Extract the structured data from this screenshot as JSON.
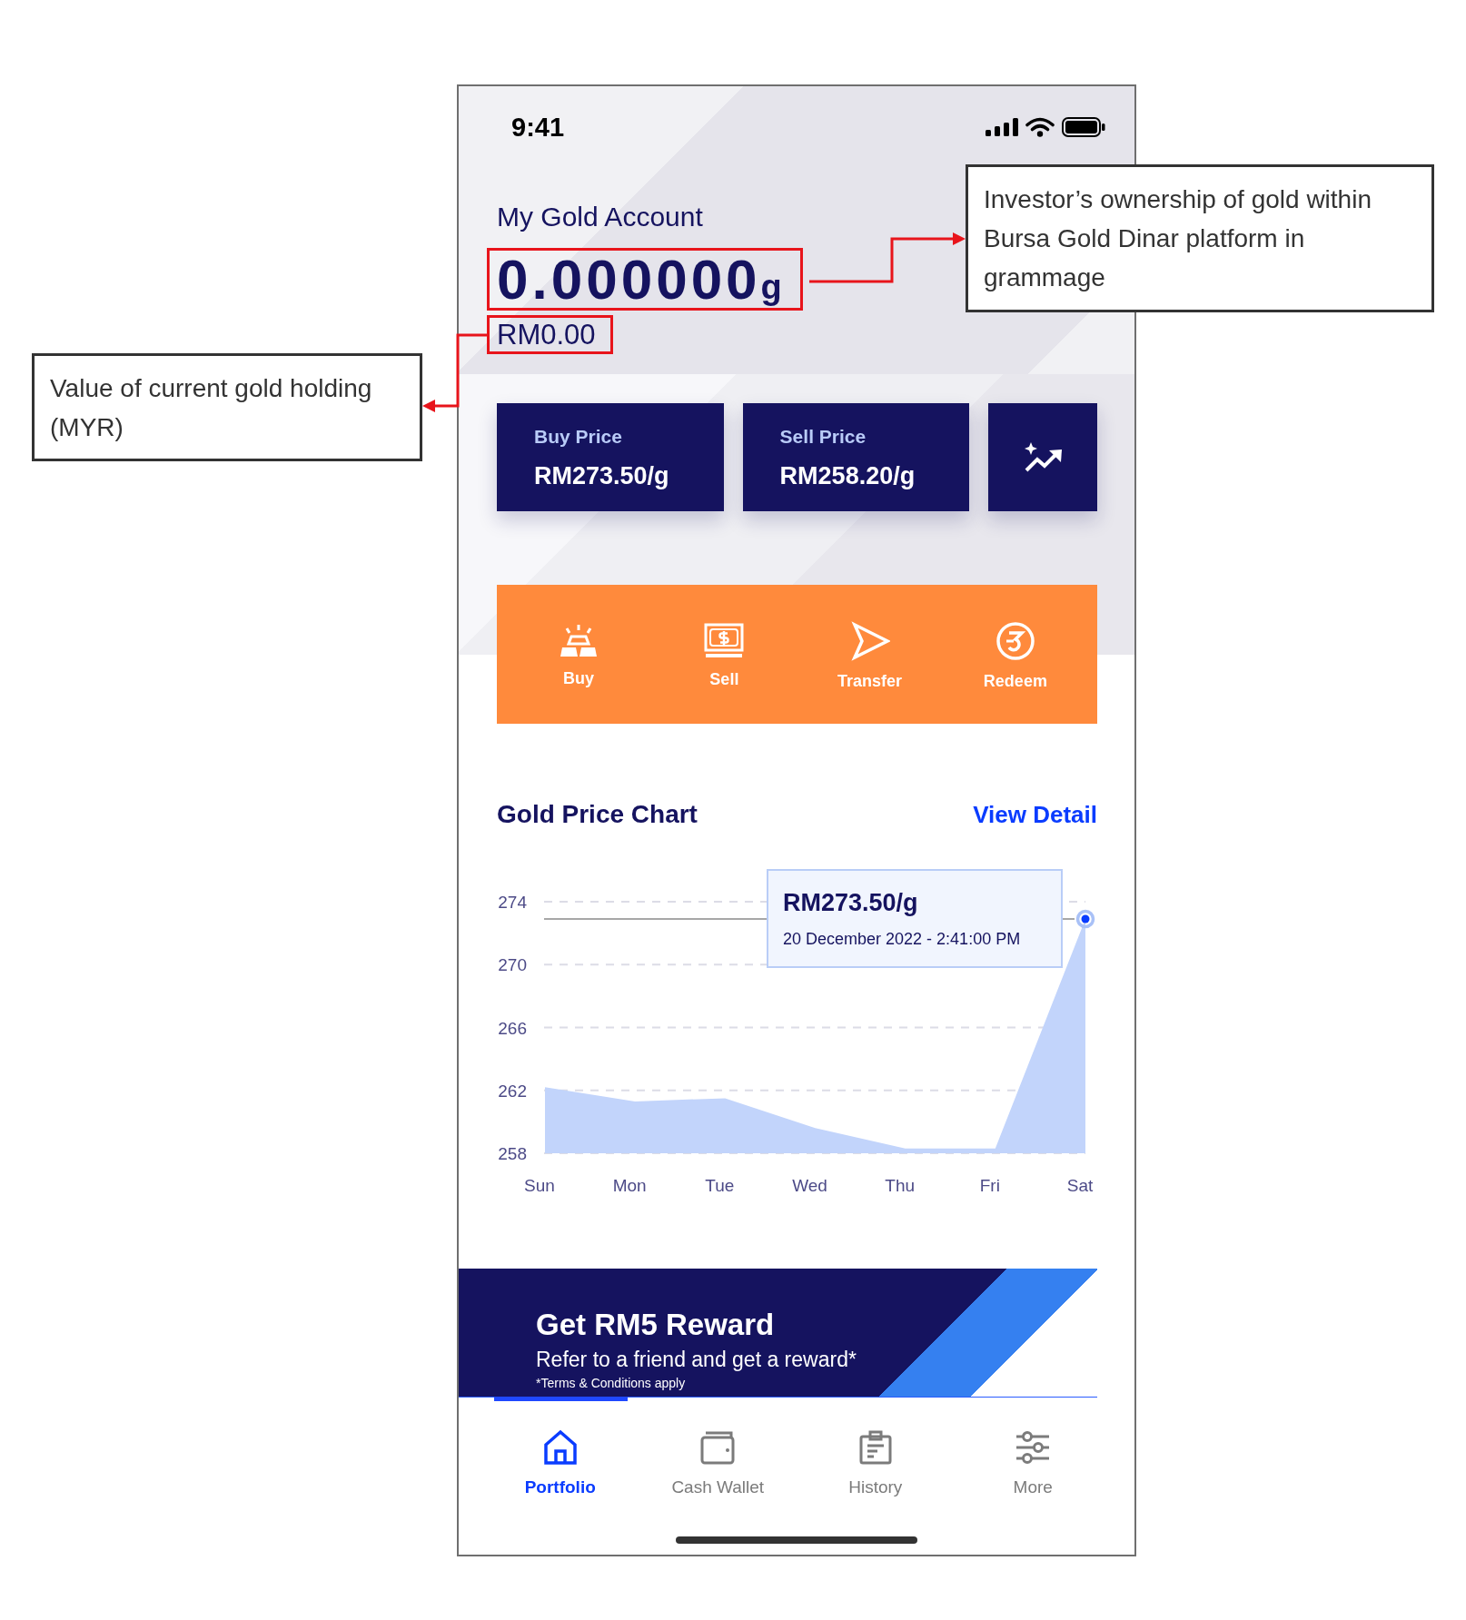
{
  "status_bar": {
    "time": "9:41"
  },
  "account": {
    "title": "My Gold Account",
    "balance": "0.000000",
    "unit": "g",
    "value": "RM0.00"
  },
  "price_cards": [
    {
      "label": "Buy Price",
      "value": "RM273.50/g"
    },
    {
      "label": "Sell Price",
      "value": "RM258.20/g"
    }
  ],
  "actions": [
    {
      "kind": "buy",
      "label": "Buy"
    },
    {
      "kind": "sell",
      "label": "Sell"
    },
    {
      "kind": "transfer",
      "label": "Transfer"
    },
    {
      "kind": "redeem",
      "label": "Redeem"
    }
  ],
  "gold_price_chart": {
    "title": "Gold Price Chart",
    "link": "View Detail",
    "chart_data": {
      "type": "area",
      "categories": [
        "Sun",
        "Mon",
        "Tue",
        "Wed",
        "Thu",
        "Fri",
        "Sat"
      ],
      "series": [
        {
          "color": "#c2d4fb",
          "values": [
            262.2,
            261.3,
            261.5,
            259.6,
            258.3,
            258.3,
            272.9
          ]
        }
      ],
      "ylim": [
        258,
        274
      ],
      "yticks": [
        258,
        262,
        266,
        270,
        274
      ],
      "grid": true,
      "ref_lines": [
        {
          "axis": "y",
          "value": 272.9
        }
      ]
    },
    "tooltip": {
      "price": "RM273.50/g",
      "timestamp": "20 December 2022 - 2:41:00 PM"
    }
  },
  "promo_banner": {
    "title": "Get RM5 Reward",
    "subtitle": "Refer to a friend and get a reward*",
    "terms": "*Terms & Conditions apply"
  },
  "bottom_nav": [
    {
      "kind": "home",
      "label": "Portfolio",
      "selected": true
    },
    {
      "kind": "wallet",
      "label": "Cash Wallet",
      "selected": false
    },
    {
      "kind": "history",
      "label": "History",
      "selected": false
    },
    {
      "kind": "more",
      "label": "More",
      "selected": false
    }
  ],
  "annotations": [
    {
      "kind": "balance",
      "text": "Investor’s ownership of gold within Bursa Gold Dinar platform in grammage"
    },
    {
      "kind": "value",
      "text": "Value of current gold holding (MYR)"
    }
  ]
}
